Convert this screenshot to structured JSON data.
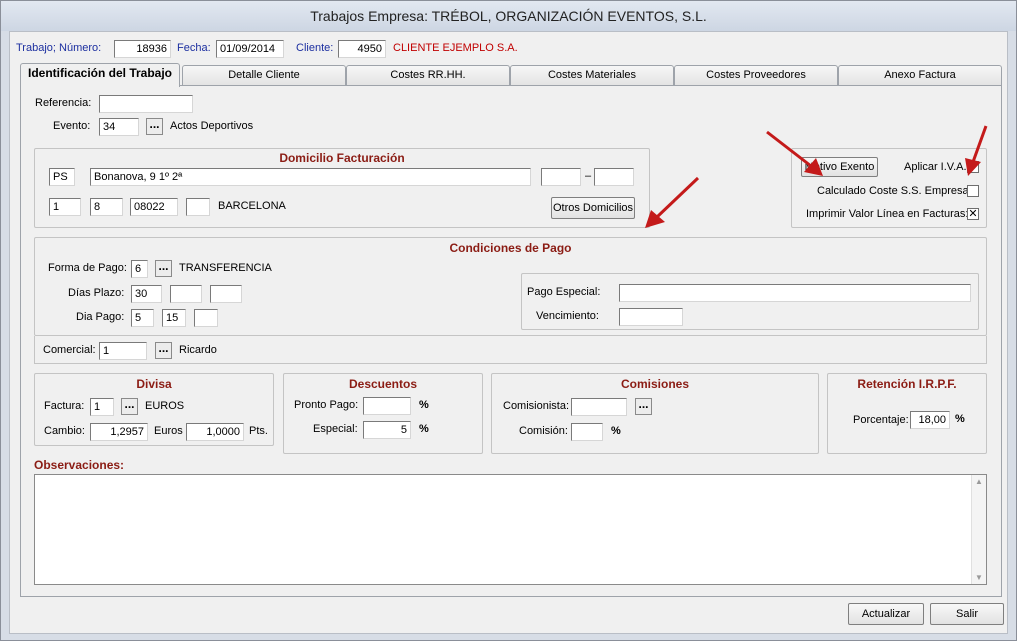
{
  "window": {
    "title": "Trabajos Empresa: TRÉBOL, ORGANIZACIÓN EVENTOS, S.L."
  },
  "header": {
    "trabajo_label": "Trabajo; Número:",
    "trabajo_value": "18936",
    "fecha_label": "Fecha:",
    "fecha_value": "01/09/2014",
    "cliente_label": "Cliente:",
    "cliente_value": "4950",
    "cliente_name": "CLIENTE EJEMPLO S.A."
  },
  "tabs": [
    {
      "label": "Identificación del Trabajo",
      "active": true
    },
    {
      "label": "Detalle Cliente"
    },
    {
      "label": "Costes RR.HH."
    },
    {
      "label": "Costes Materiales"
    },
    {
      "label": "Costes Proveedores"
    },
    {
      "label": "Anexo Factura"
    }
  ],
  "ident": {
    "referencia_label": "Referencia:",
    "referencia_value": "",
    "evento_label": "Evento:",
    "evento_value": "34",
    "evento_name": "Actos Deportivos",
    "dots": "..."
  },
  "domicilio": {
    "title": "Domicilio Facturación",
    "via": "PS",
    "calle": "Bonanova, 9 1º 2ª",
    "extra1": "",
    "dash": "–",
    "extra2": "",
    "c1": "1",
    "c2": "8",
    "cp": "08022",
    "c4": "",
    "ciudad": "BARCELONA",
    "otros_button": "Otros Domicilios"
  },
  "options": {
    "motivo_button": "Motivo Exento",
    "aplicar_iva_label": "Aplicar I.V.A.:",
    "aplicar_iva_checked": false,
    "calculado_label": "Calculado Coste S.S. Empresa:",
    "calculado_checked": false,
    "imprimir_label": "Imprimir Valor Línea en Facturas:",
    "imprimir_checked": true,
    "check_mark": "✕"
  },
  "pago": {
    "title": "Condiciones de Pago",
    "forma_label": "Forma de Pago:",
    "forma_value": "6",
    "forma_name": "TRANSFERENCIA",
    "dias_label": "Días Plazo:",
    "dias1": "30",
    "dias2": "",
    "dias3": "",
    "diapago_label": "Dia Pago:",
    "dp1": "5",
    "dp2": "15",
    "dp3": "",
    "especial_label": "Pago Especial:",
    "especial_value": "",
    "vencimiento_label": "Vencimiento:",
    "vencimiento_value": ""
  },
  "comercial": {
    "label": "Comercial:",
    "value": "1",
    "name": "Ricardo"
  },
  "divisa": {
    "title": "Divisa",
    "factura_label": "Factura:",
    "factura_value": "1",
    "factura_name": "EUROS",
    "cambio_label": "Cambio:",
    "cambio_value": "1,2957",
    "euros_label": "Euros",
    "euros_value": "1,0000",
    "pts_label": "Pts."
  },
  "descuentos": {
    "title": "Descuentos",
    "pronto_label": "Pronto Pago:",
    "pronto_value": "",
    "especial_label": "Especial:",
    "especial_value": "5",
    "pct": "%"
  },
  "comisiones": {
    "title": "Comisiones",
    "comisionista_label": "Comisionista:",
    "comisionista_value": "",
    "comision_label": "Comisión:",
    "comision_value": "",
    "pct": "%"
  },
  "irpf": {
    "title": "Retención I.R.P.F.",
    "porcentaje_label": "Porcentaje:",
    "porcentaje_value": "18,00",
    "pct": "%"
  },
  "observaciones": {
    "label": "Observaciones:",
    "value": ""
  },
  "footer": {
    "actualizar": "Actualizar",
    "salir": "Salir"
  },
  "colors": {
    "section_title": "#8b1c14",
    "header_blue": "#1c2fa0",
    "client_red": "#c00000",
    "arrow": "#c41a1a"
  }
}
